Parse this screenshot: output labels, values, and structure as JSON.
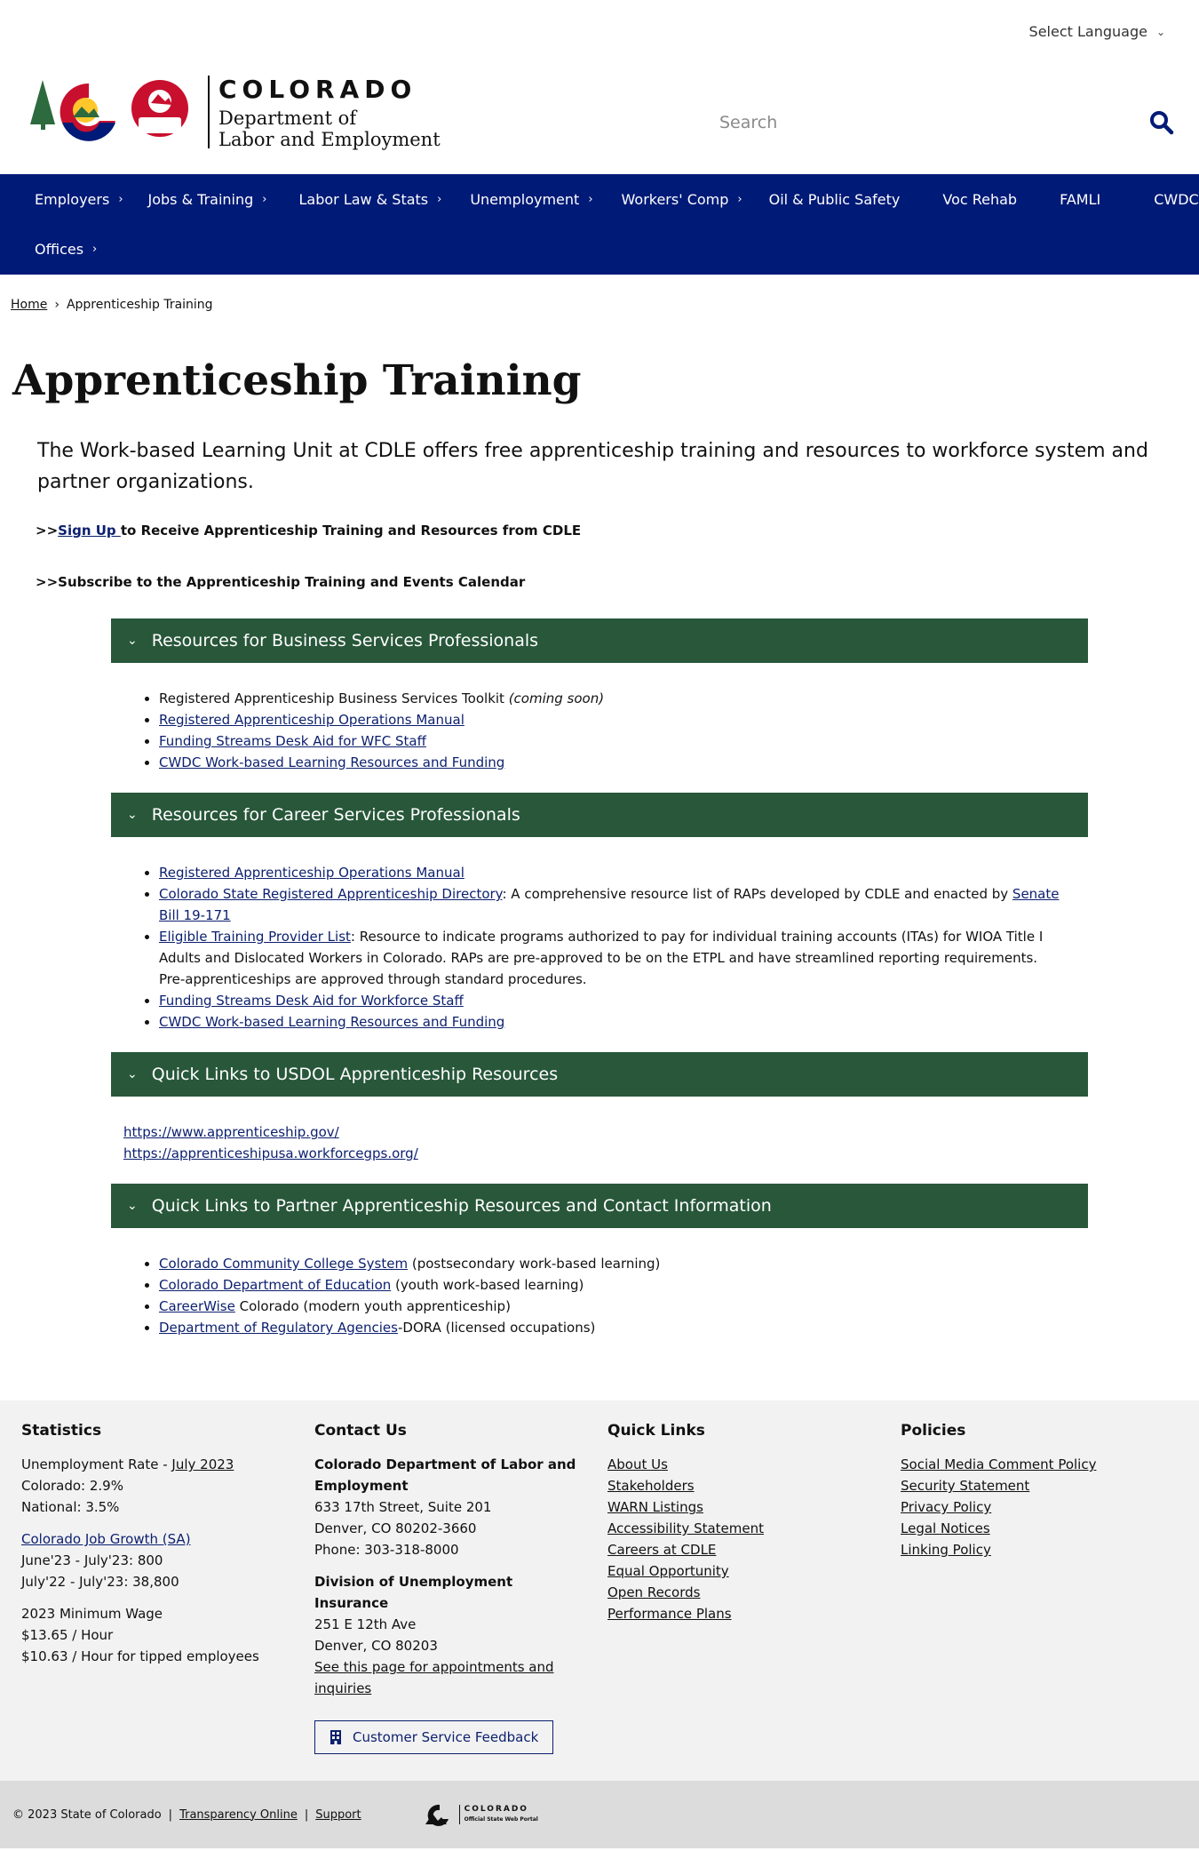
{
  "header": {
    "language_label": "Select Language",
    "logo_state": "COLORADO",
    "logo_dept_line1": "Department of",
    "logo_dept_line2": "Labor and Employment",
    "logo_badge": "CDLE",
    "search_placeholder": "Search"
  },
  "nav": {
    "row1": [
      {
        "label": "Employers",
        "has_caret": true
      },
      {
        "label": "Jobs & Training",
        "has_caret": true
      },
      {
        "label": "Labor Law & Stats",
        "has_caret": true
      },
      {
        "label": "Unemployment",
        "has_caret": true
      },
      {
        "label": "Workers' Comp",
        "has_caret": true
      },
      {
        "label": "Oil & Public Safety",
        "has_caret": false
      },
      {
        "label": "Voc Rehab",
        "has_caret": false
      },
      {
        "label": "FAMLI",
        "has_caret": false
      },
      {
        "label": "CWDC",
        "has_caret": false
      }
    ],
    "row2": [
      {
        "label": "Offices",
        "has_caret": true
      }
    ]
  },
  "breadcrumb": {
    "home": "Home",
    "separator": "›",
    "current": "Apprenticeship Training"
  },
  "page": {
    "title": "Apprenticeship Training",
    "intro": "The Work-based Learning Unit at CDLE offers free apprenticeship training and resources to workforce system and partner organizations.",
    "cta1_prefix": ">>",
    "cta1_link": "Sign Up ",
    "cta1_rest": "to Receive Apprenticeship Training and Resources from CDLE",
    "cta2": ">>Subscribe to the Apprenticeship Training and Events Calendar"
  },
  "accordions": {
    "business": {
      "title": "Resources for Business Services Professionals",
      "item1_text": "Registered Apprenticeship Business Services Toolkit ",
      "item1_note": "(coming soon)",
      "item2": "Registered Apprenticeship Operations Manual",
      "item3": "Funding Streams Desk Aid for WFC Staff",
      "item4": "CWDC Work-based Learning Resources and Funding"
    },
    "career": {
      "title": "Resources for Career Services Professionals",
      "item1": "Registered Apprenticeship Operations Manual",
      "item2_link": "Colorado State Registered Apprenticeship Directory",
      "item2_text": ": A comprehensive resource list of RAPs developed by CDLE and enacted by ",
      "item2_link2": "Senate Bill 19-171",
      "item3_link": "Eligible Training Provider List",
      "item3_text": ": Resource to indicate programs authorized to pay for individual training accounts (ITAs) for WIOA Title I Adults and Dislocated Workers in Colorado. RAPs are pre-approved to be on the ETPL and have streamlined reporting requirements. Pre-apprenticeships are approved through standard procedures.",
      "item4": "Funding Streams Desk Aid for Workforce Staff",
      "item5": "CWDC Work-based Learning Resources and Funding"
    },
    "usdol": {
      "title": "Quick Links to USDOL Apprenticeship Resources",
      "link1": "https://www.apprenticeship.gov/",
      "link2": "https://apprenticeshipusa.workforcegps.org/"
    },
    "partner": {
      "title": "Quick Links to Partner Apprenticeship Resources and Contact Information",
      "item1_link": "Colorado Community College System",
      "item1_text": " (postsecondary work-based learning)",
      "item2_link": "Colorado Department of Education",
      "item2_text": " (youth work-based learning)",
      "item3_link": "CareerWise",
      "item3_text": " Colorado (modern youth apprenticeship)",
      "item4_link": "Department of Regulatory Agencies",
      "item4_text": "-DORA (licensed occupations)"
    }
  },
  "footer": {
    "statistics": {
      "title": "Statistics",
      "unemp_prefix": "Unemployment Rate - ",
      "unemp_link": "July 2023",
      "colorado": "Colorado: 2.9%",
      "national": "National: 3.5%",
      "job_growth_link": "Colorado Job Growth (SA)",
      "jg1": "June'23 - July'23: 800",
      "jg2": "July'22 - July'23: 38,800",
      "wage_title": "2023 Minimum Wage",
      "wage1": "$13.65 / Hour",
      "wage2": "$10.63 / Hour for tipped employees"
    },
    "contact": {
      "title": "Contact Us",
      "org": "Colorado Department of Labor and Employment",
      "addr1": "633 17th Street, Suite 201",
      "addr2": "Denver, CO  80202-3660",
      "phone": "Phone: 303-318-8000",
      "div": "Division of Unemployment Insurance",
      "div_addr1": "251 E 12th Ave",
      "div_addr2": "Denver, CO  80203",
      "appt_link": "See this page for appointments and inquiries",
      "feedback": "Customer Service Feedback"
    },
    "quick_links": {
      "title": "Quick Links",
      "items": [
        "About Us",
        "Stakeholders",
        "WARN Listings",
        "Accessibility Statement",
        "Careers at CDLE",
        "Equal Opportunity",
        "Open Records",
        "Performance Plans"
      ]
    },
    "policies": {
      "title": "Policies",
      "items": [
        "Social Media Comment Policy",
        "Security Statement",
        "Privacy Policy",
        "Legal Notices",
        "Linking Policy"
      ]
    }
  },
  "bottombar": {
    "copyright": "© 2023 State of Colorado",
    "sep": "|",
    "transparency": "Transparency Online",
    "support": "Support",
    "portal_line1": "COLORADO",
    "portal_line2": "Official State Web Portal"
  },
  "colors": {
    "nav_blue": "#001a77",
    "accordion_green": "#28573a",
    "link_blue": "#0b1f6e",
    "logo_red": "#c8102e",
    "logo_gold": "#ffc72c",
    "logo_green": "#2d6a3e"
  }
}
